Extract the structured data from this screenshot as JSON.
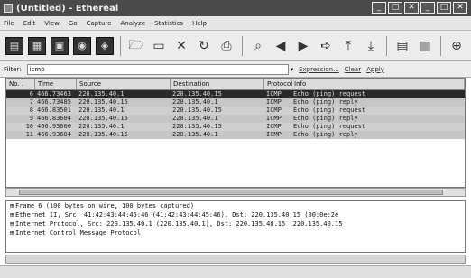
{
  "window": {
    "title": "(Untitled) - Ethereal",
    "buttons": [
      "_",
      "□",
      "✕",
      "_",
      "□",
      "✕"
    ]
  },
  "menu": [
    "File",
    "Edit",
    "View",
    "Go",
    "Capture",
    "Analyze",
    "Statistics",
    "Help"
  ],
  "toolbar": {
    "icons": [
      "interfaces-icon",
      "options-icon",
      "start-icon",
      "stop-icon",
      "restart-icon",
      "open-icon",
      "save-icon",
      "close-icon",
      "reload-icon",
      "print-icon",
      "find-icon",
      "back-icon",
      "forward-icon",
      "goto-icon",
      "top-icon",
      "bottom-icon",
      "colorize-icon",
      "autoscroll-icon",
      "zoom-in-icon"
    ]
  },
  "filter": {
    "label": "Filter:",
    "value": "icmp",
    "dropdown": "▾",
    "expression": "Expression...",
    "clear": "Clear",
    "apply": "Apply"
  },
  "columns": [
    "No. .",
    "Time",
    "Source",
    "Destination",
    "Protocol",
    "Info"
  ],
  "packets": [
    {
      "no": "6",
      "time": "466.73463",
      "src": "220.135.40.1",
      "dst": "220.135.40.15",
      "proto": "ICMP",
      "info": "Echo (ping) request",
      "selected": true
    },
    {
      "no": "7",
      "time": "466.73485",
      "src": "220.135.40.15",
      "dst": "220.135.40.1",
      "proto": "ICMP",
      "info": "Echo (ping) reply",
      "selected": false
    },
    {
      "no": "8",
      "time": "466.83501",
      "src": "220.135.40.1",
      "dst": "220.135.40.15",
      "proto": "ICMP",
      "info": "Echo (ping) request",
      "selected": false
    },
    {
      "no": "9",
      "time": "466.83604",
      "src": "220.135.40.15",
      "dst": "220.135.40.1",
      "proto": "ICMP",
      "info": "Echo (ping) reply",
      "selected": false
    },
    {
      "no": "10",
      "time": "466.93600",
      "src": "220.135.40.1",
      "dst": "220.135.40.15",
      "proto": "ICMP",
      "info": "Echo (ping) request",
      "selected": false
    },
    {
      "no": "11",
      "time": "466.93604",
      "src": "220.135.40.15",
      "dst": "220.135.40.1",
      "proto": "ICMP",
      "info": "Echo (ping) reply",
      "selected": false
    }
  ],
  "details": [
    {
      "expander": "⊞",
      "text": "Frame 6 (100 bytes on wire, 100 bytes captured)"
    },
    {
      "expander": "⊞",
      "text": "Ethernet II, Src: 41:42:43:44:45:46 (41:42:43:44:45:46), Dst: 220.135.40.15 (00:0e:2e"
    },
    {
      "expander": "⊞",
      "text": "Internet Protocol, Src: 220.135.40.1 (220.135.40.1), Dst: 220.135.40.15 (220.135.40.15"
    },
    {
      "expander": "⊞",
      "text": "Internet Control Message Protocol"
    }
  ]
}
